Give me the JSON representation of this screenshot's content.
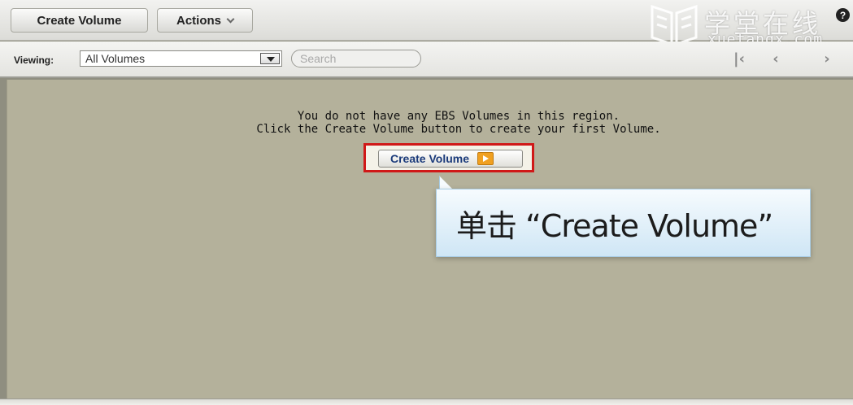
{
  "toolbar": {
    "create_volume_label": "Create Volume",
    "actions_label": "Actions"
  },
  "watermark": {
    "chinese": "学堂在线",
    "domain": "xuetangx.com"
  },
  "help_icon": "?",
  "filter": {
    "viewing_label": "Viewing:",
    "selected_option": "All Volumes",
    "search_placeholder": "Search"
  },
  "pager": {
    "first": "|‹",
    "prev": "‹",
    "next": "›"
  },
  "empty_state": {
    "line1": "You do not have any EBS Volumes in this region.",
    "line2": "Click the Create Volume button to create your first Volume.",
    "button_label": "Create Volume"
  },
  "callout": {
    "text": "单击 “Create Volume”"
  },
  "colors": {
    "content_bg": "#b4b19b",
    "highlight": "#d01818",
    "callout_bg": "#dcecf7"
  }
}
